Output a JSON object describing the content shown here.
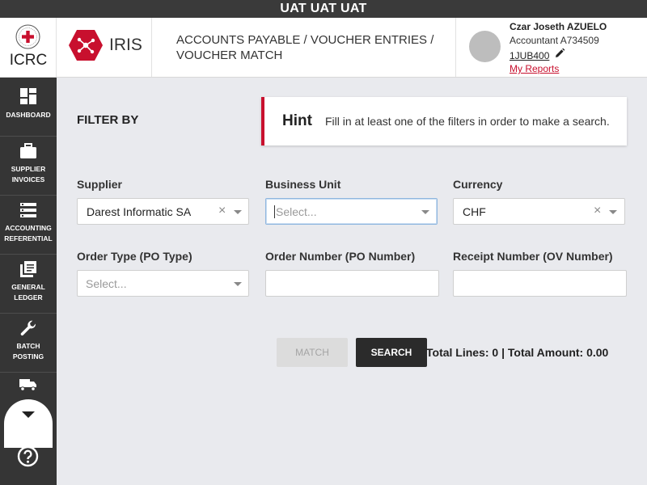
{
  "env_banner": "UAT UAT UAT",
  "logos": {
    "org": "ICRC",
    "app": "IRIS"
  },
  "breadcrumb": {
    "line1": "ACCOUNTS PAYABLE / VOUCHER ENTRIES /",
    "line2": "VOUCHER MATCH"
  },
  "user": {
    "name": "Czar Joseth AZUELO",
    "role": "Accountant A734509",
    "code": "1JUB400",
    "reports_link": "My Reports"
  },
  "sidebar": {
    "items": [
      {
        "l1": "DASHBOARD",
        "l2": "",
        "icon": "dashboard-icon"
      },
      {
        "l1": "SUPPLIER",
        "l2": "INVOICES",
        "icon": "briefcase-icon"
      },
      {
        "l1": "ACCOUNTING",
        "l2": "REFERENTIAL",
        "icon": "list-icon"
      },
      {
        "l1": "GENERAL",
        "l2": "LEDGER",
        "icon": "ledger-icon"
      },
      {
        "l1": "BATCH",
        "l2": "POSTING",
        "icon": "wrench-icon"
      }
    ],
    "partial_icon": "truck-icon",
    "scroll_icon": "chevron-down-icon",
    "help_icon": "help-icon"
  },
  "filter": {
    "title": "FILTER BY",
    "hint_title": "Hint",
    "hint_text": "Fill in at least one of the filters in order to make a search.",
    "supplier": {
      "label": "Supplier",
      "value": "Darest Informatic SA"
    },
    "business_unit": {
      "label": "Business Unit",
      "placeholder": "Select..."
    },
    "currency": {
      "label": "Currency",
      "value": "CHF"
    },
    "order_type": {
      "label": "Order Type (PO Type)",
      "placeholder": "Select..."
    },
    "order_number": {
      "label": "Order Number (PO Number)",
      "value": ""
    },
    "receipt_number": {
      "label": "Receipt Number (OV Number)",
      "value": ""
    }
  },
  "actions": {
    "match_label": "MATCH",
    "search_label": "SEARCH",
    "totals_text": "Total Lines: 0 | Total Amount: 0.00"
  },
  "colors": {
    "brand_red": "#c8102e",
    "sidebar_bg": "#353535",
    "env_bar": "#3a3a3a"
  }
}
